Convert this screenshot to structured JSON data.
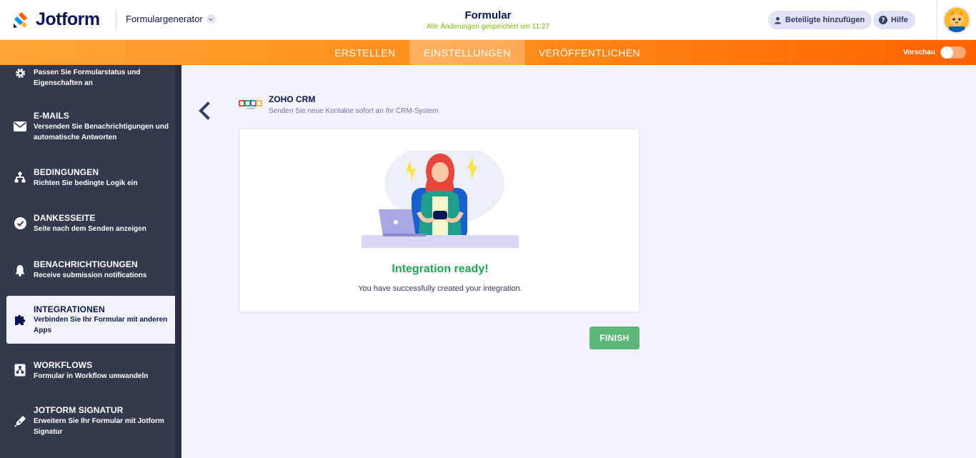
{
  "header": {
    "logo_text": "Jotform",
    "builder_label": "Formulargenerator",
    "form_title": "Formular",
    "save_status": "Alle Änderungen gespeichert um 11:27",
    "share_label": "Beteiligte hinzufügen",
    "help_label": "Hilfe"
  },
  "nav": {
    "tabs": [
      {
        "label": "ERSTELLEN"
      },
      {
        "label": "EINSTELLUNGEN",
        "active": true
      },
      {
        "label": "VERÖFFENTLICHEN"
      }
    ],
    "preview_label": "Vorschau",
    "preview_on": false
  },
  "sidebar": {
    "items": [
      {
        "title": "",
        "desc": "Passen Sie Formularstatus und Eigenschaften an",
        "icon": "gear-icon"
      },
      {
        "title": "E-MAILS",
        "desc": "Versenden Sie Benachrichtigungen und automatische Antworten",
        "icon": "envelope-icon"
      },
      {
        "title": "BEDINGUNGEN",
        "desc": "Richten Sie bedingte Logik ein",
        "icon": "sitemap-icon"
      },
      {
        "title": "DANKESSEITE",
        "desc": "Seite nach dem Senden anzeigen",
        "icon": "check-circle-icon"
      },
      {
        "title": "BENACHRICHTIGUNGEN",
        "desc": "Receive submission notifications",
        "icon": "bell-icon"
      },
      {
        "title": "INTEGRATIONEN",
        "desc": "Verbinden Sie Ihr Formular mit anderen Apps",
        "icon": "puzzle-icon",
        "active": true
      },
      {
        "title": "WORKFLOWS",
        "desc": "Formular in Workflow umwandeln",
        "icon": "workflow-icon"
      },
      {
        "title": "JOTFORM SIGNATUR",
        "desc": "Erweitern Sie Ihr Formular mit Jotform Signatur",
        "icon": "pen-icon"
      }
    ]
  },
  "integration": {
    "name": "ZOHO CRM",
    "description": "Senden Sie neue Kontakte sofort an Ihr CRM-System",
    "status_title": "Integration ready!",
    "status_message": "You have successfully created your integration.",
    "finish_label": "FINISH"
  },
  "colors": {
    "brand_orange": "#ff8a15",
    "sidebar_bg": "#333a4e",
    "success_green": "#1ea94d",
    "finish_button": "#5cb877",
    "save_status_green": "#78bb07"
  }
}
